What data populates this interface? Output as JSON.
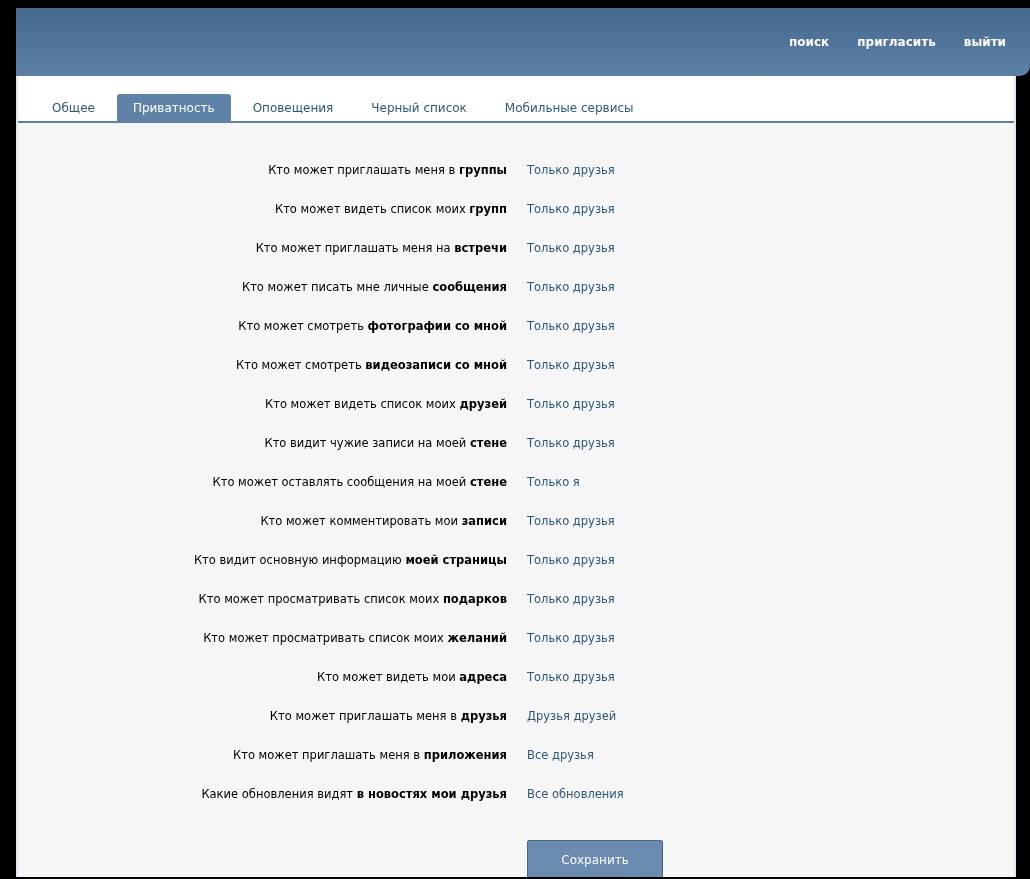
{
  "header": {
    "links": [
      "поиск",
      "пригласить",
      "выйти"
    ]
  },
  "tabs": [
    {
      "label": "Общее",
      "selected": false
    },
    {
      "label": "Приватность",
      "selected": true
    },
    {
      "label": "Оповещения",
      "selected": false
    },
    {
      "label": "Черный список",
      "selected": false
    },
    {
      "label": "Мобильные сервисы",
      "selected": false
    }
  ],
  "settings": [
    {
      "label": "Кто может приглашать меня в **группы**",
      "value": "Только друзья"
    },
    {
      "label": "Кто может видеть список моих **групп**",
      "value": "Только друзья"
    },
    {
      "label": "Кто может приглашать меня на **встречи**",
      "value": "Только друзья"
    },
    {
      "label": "Кто может писать мне личные **сообщения**",
      "value": "Только друзья"
    },
    {
      "label": "Кто может смотреть **фотографии со мной**",
      "value": "Только друзья"
    },
    {
      "label": "Кто может смотреть **видеозаписи со мной**",
      "value": "Только друзья"
    },
    {
      "label": "Кто может видеть список моих **друзей**",
      "value": "Только друзья"
    },
    {
      "label": "Кто видит чужие записи на моей **стене**",
      "value": "Только друзья"
    },
    {
      "label": "Кто может оставлять сообщения на моей **стене**",
      "value": "Только я"
    },
    {
      "label": "Кто может комментировать мои **записи**",
      "value": "Только друзья"
    },
    {
      "label": "Кто видит основную информацию **моей страницы**",
      "value": "Только друзья"
    },
    {
      "label": "Кто может просматривать список моих **подарков**",
      "value": "Только друзья"
    },
    {
      "label": "Кто может просматривать список моих **желаний**",
      "value": "Только друзья"
    },
    {
      "label": "Кто может видеть мои **адреса**",
      "value": "Только друзья"
    },
    {
      "label": "Кто может приглашать меня в **друзья**",
      "value": "Друзья друзей"
    },
    {
      "label": "Кто может приглашать меня в **приложения**",
      "value": "Все друзья"
    },
    {
      "label": "Какие обновления видят **в новостях мои друзья**",
      "value": "Все обновления"
    }
  ],
  "save_button": "Сохранить"
}
